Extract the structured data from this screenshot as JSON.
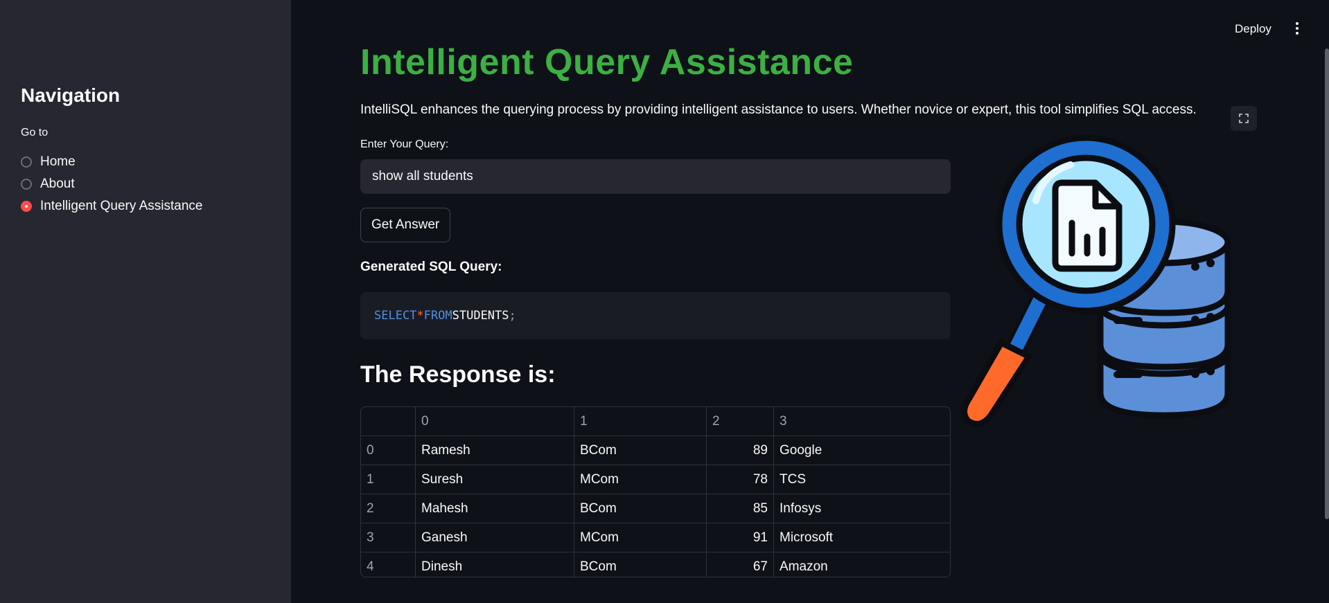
{
  "sidebar": {
    "title": "Navigation",
    "goto_label": "Go to",
    "options": [
      {
        "label": "Home",
        "selected": false
      },
      {
        "label": "About",
        "selected": false
      },
      {
        "label": "Intelligent Query Assistance",
        "selected": true
      }
    ]
  },
  "header": {
    "deploy_label": "Deploy",
    "menu_icon": "kebab-menu-icon"
  },
  "main": {
    "title": "Intelligent Query Assistance",
    "description": "IntelliSQL enhances the querying process by providing intelligent assistance to users. Whether novice or expert, this tool simplifies SQL access.",
    "query_label": "Enter Your Query:",
    "query_value": "show all students",
    "button_label": "Get Answer",
    "sql_label": "Generated SQL Query:",
    "sql_tokens": {
      "select": "SELECT",
      "star": "*",
      "from": "FROM",
      "table": "STUDENTS",
      "semicolon": ";"
    },
    "response_title": "The Response is:",
    "table": {
      "columns": [
        "0",
        "1",
        "2",
        "3"
      ],
      "rows": [
        {
          "index": "0",
          "cells": [
            "Ramesh",
            "BCom",
            "89",
            "Google"
          ]
        },
        {
          "index": "1",
          "cells": [
            "Suresh",
            "MCom",
            "78",
            "TCS"
          ]
        },
        {
          "index": "2",
          "cells": [
            "Mahesh",
            "BCom",
            "85",
            "Infosys"
          ]
        },
        {
          "index": "3",
          "cells": [
            "Ganesh",
            "MCom",
            "91",
            "Microsoft"
          ]
        },
        {
          "index": "4",
          "cells": [
            "Dinesh",
            "BCom",
            "67",
            "Amazon"
          ]
        }
      ]
    },
    "image_icon": "database-search-illustration",
    "fullscreen_icon": "fullscreen-icon"
  },
  "colors": {
    "accent": "#ff4b4b",
    "title_green": "#3cb043",
    "background": "#0e1117",
    "sidebar_bg": "#262730"
  }
}
